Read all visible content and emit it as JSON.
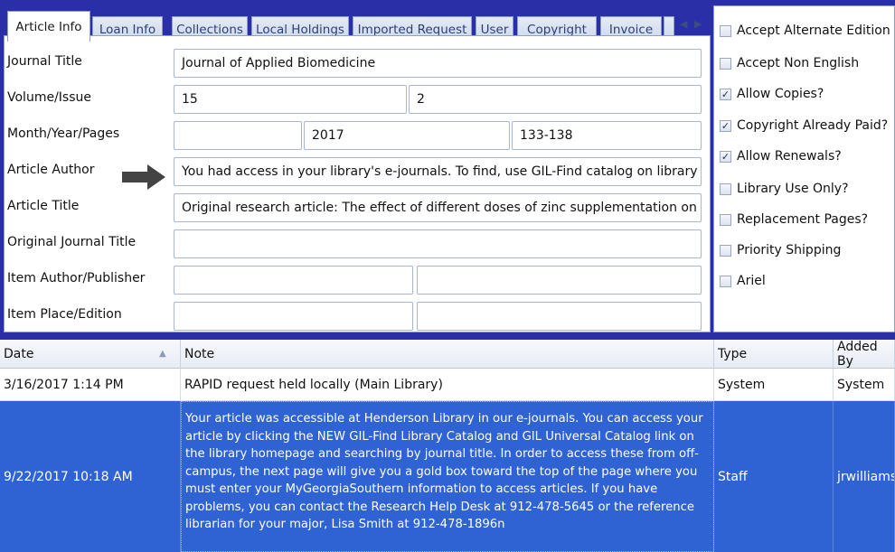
{
  "tabs": [
    {
      "label": "Article Info",
      "active": true
    },
    {
      "label": "Loan Info"
    },
    {
      "label": "Collections"
    },
    {
      "label": "Local Holdings"
    },
    {
      "label": "Imported Request"
    },
    {
      "label": "User"
    },
    {
      "label": "Copyright"
    },
    {
      "label": "Invoice"
    }
  ],
  "form": {
    "journal_title": {
      "label": "Journal Title",
      "value": "Journal of Applied Biomedicine"
    },
    "volume_issue": {
      "label": "Volume/Issue",
      "volume": "15",
      "issue": "2"
    },
    "month_year_pages": {
      "label": "Month/Year/Pages",
      "month": "",
      "year": "2017",
      "pages": "133-138"
    },
    "article_author": {
      "label": "Article Author",
      "value": "You had access in your library's e-journals.  To find, use GIL-Find catalog on library homepa"
    },
    "article_title": {
      "label": "Article Title",
      "value": "Original research article: The effect of different doses of zinc supplementation on serum ele"
    },
    "original_journal_title": {
      "label": "Original Journal Title",
      "value": ""
    },
    "item_author_publisher": {
      "label": "Item Author/Publisher",
      "value1": "",
      "value2": ""
    },
    "item_place_edition": {
      "label": "Item Place/Edition",
      "value1": "",
      "value2": ""
    }
  },
  "options": [
    {
      "label": "Accept Alternate Edition",
      "checked": false
    },
    {
      "label": "Accept Non English",
      "checked": false
    },
    {
      "label": "Allow Copies?",
      "checked": true
    },
    {
      "label": "Copyright Already Paid?",
      "checked": true
    },
    {
      "label": "Allow Renewals?",
      "checked": true
    },
    {
      "label": "Library Use Only?",
      "checked": false
    },
    {
      "label": "Replacement Pages?",
      "checked": false
    },
    {
      "label": "Priority Shipping",
      "checked": false
    },
    {
      "label": "Ariel",
      "checked": false
    }
  ],
  "grid": {
    "columns": [
      "Date",
      "Note",
      "Type",
      "Added By"
    ],
    "rows": [
      {
        "date": "3/16/2017 1:14 PM",
        "note": "RAPID request held locally (Main Library)",
        "type": "System",
        "added_by": "System"
      },
      {
        "date": "9/22/2017 10:18 AM",
        "note": "Your article was accessible at Henderson Library in our e-journals.  You can access your article by clicking the NEW GIL-Find Library Catalog and GIL Universal Catalog link on the library homepage and searching by journal title.  In order to access these from off-campus, the next page will give you a gold box toward the top of the page where you must enter your MyGeorgiaSouthern information to access articles.  If you have problems, you can contact the Research Help Desk at 912-478-5645 or the reference librarian for your major, Lisa Smith at 912-478-1896n",
        "type": "Staff",
        "added_by": "jrwilliams"
      }
    ]
  },
  "colors": {
    "background": "#2a2fa8",
    "selected_row": "#2f63d4",
    "arrow": "#444444"
  },
  "icons": {
    "scroll_left": "tab-scroll-left-icon",
    "scroll_right": "tab-scroll-right-icon",
    "sort": "sort-ascending-icon",
    "pointer": "pointer-arrow-icon"
  }
}
